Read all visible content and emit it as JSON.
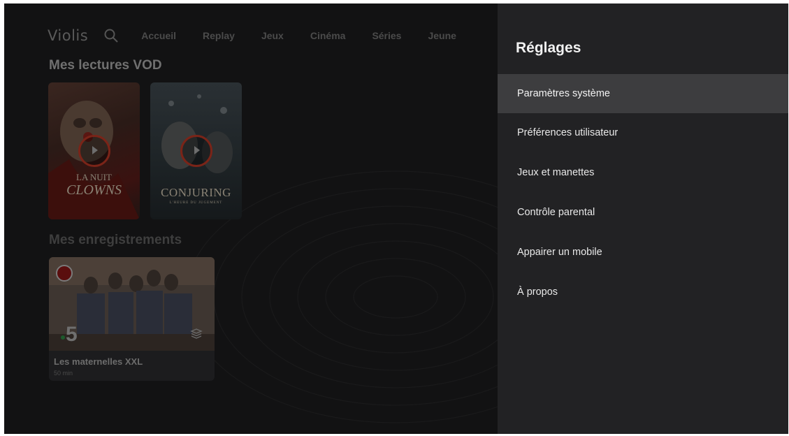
{
  "header": {
    "logo": "Violis",
    "nav": [
      "Accueil",
      "Replay",
      "Jeux",
      "Cinéma",
      "Séries",
      "Jeune"
    ]
  },
  "vod": {
    "title": "Mes lectures VOD",
    "items": [
      {
        "title_line1": "LA NUIT",
        "title_line2": "CLOWNS"
      },
      {
        "title_line1": "CONJURING",
        "title_line2": "L'HEURE DU JUGEMENT"
      }
    ]
  },
  "recordings": {
    "title": "Mes enregistrements",
    "items": [
      {
        "channel": "5",
        "title": "Les maternelles XXL",
        "duration": "50 min"
      }
    ]
  },
  "settings": {
    "title": "Réglages",
    "items": [
      "Paramètres système",
      "Préférences utilisateur",
      "Jeux et manettes",
      "Contrôle parental",
      "Appairer un mobile",
      "À propos"
    ],
    "selected_index": 0
  },
  "colors": {
    "panel_bg": "#222224",
    "selected_bg": "#3d3d3f",
    "record_red": "#5a0e0e",
    "channel_green": "#1c5a2c"
  }
}
